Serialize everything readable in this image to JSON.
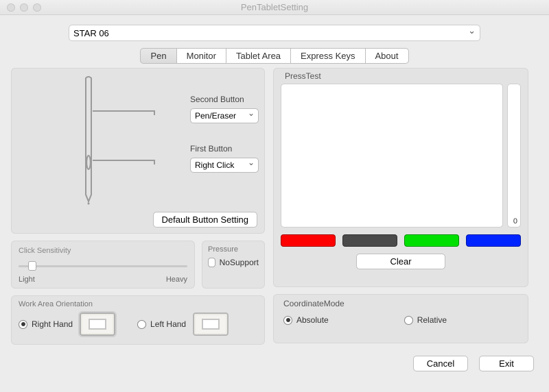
{
  "window": {
    "title": "PenTabletSetting"
  },
  "device": {
    "selected": "STAR 06"
  },
  "tabs": {
    "items": [
      "Pen",
      "Monitor",
      "Tablet Area",
      "Express Keys",
      "About"
    ],
    "active_index": 0
  },
  "pen_panel": {
    "second_button": {
      "label": "Second Button",
      "value": "Pen/Eraser"
    },
    "first_button": {
      "label": "First Button",
      "value": "Right Click"
    },
    "default_button": "Default  Button Setting"
  },
  "click_sensitivity": {
    "title": "Click Sensitivity",
    "left_label": "Light",
    "right_label": "Heavy",
    "value_pct": 8
  },
  "pressure_box": {
    "title": "Pressure",
    "checkbox_label": "NoSupport",
    "checked": false
  },
  "orientation": {
    "title": "Work Area Orientation",
    "right_hand": "Right Hand",
    "left_hand": "Left Hand",
    "value": "right"
  },
  "press_test": {
    "title": "PressTest",
    "current_value": "0",
    "colors": [
      "#ff0000",
      "#4a4a4a",
      "#00e000",
      "#0024ff"
    ],
    "clear_label": "Clear"
  },
  "coordinate_mode": {
    "title": "CoordinateMode",
    "absolute": "Absolute",
    "relative": "Relative",
    "value": "absolute"
  },
  "footer": {
    "cancel": "Cancel",
    "exit": "Exit"
  }
}
